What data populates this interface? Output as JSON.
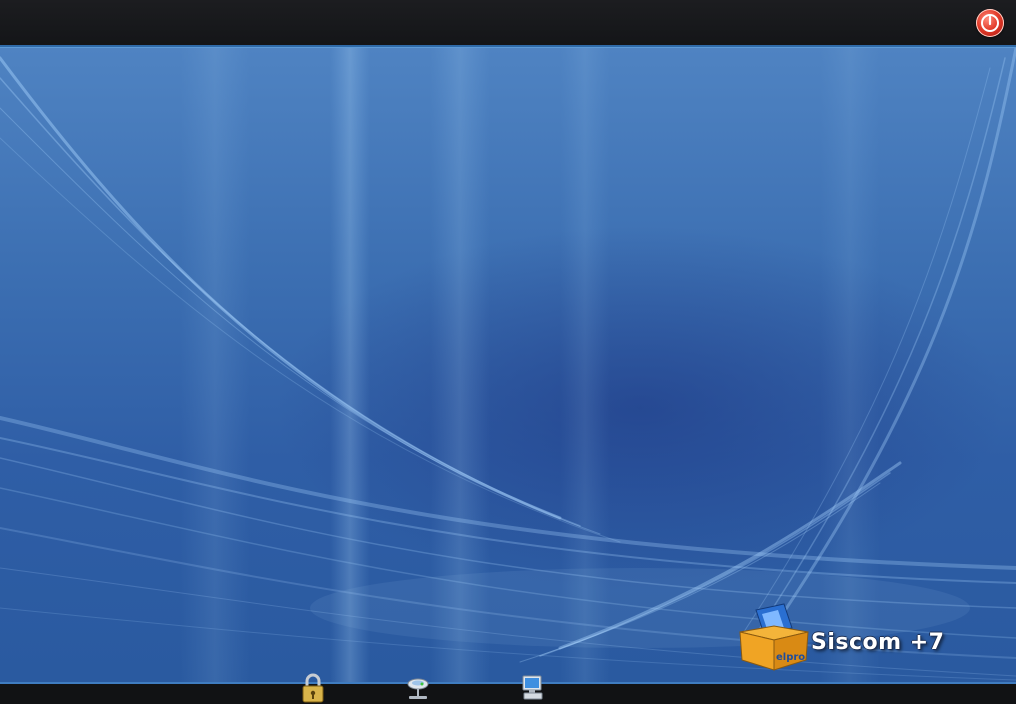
{
  "top_bar": {
    "power_button_icon": "power-icon",
    "accent_color": "#e23b2a"
  },
  "desktop": {
    "wallpaper": "blue-wave-wallpaper",
    "base_color": "#3c6fb2"
  },
  "logo": {
    "brand_text": "Siscom +7",
    "box_label": "elpro"
  },
  "taskbar": {
    "icons": [
      {
        "icon": "lock-icon"
      },
      {
        "icon": "network-icon"
      },
      {
        "icon": "computer-icon"
      }
    ]
  }
}
